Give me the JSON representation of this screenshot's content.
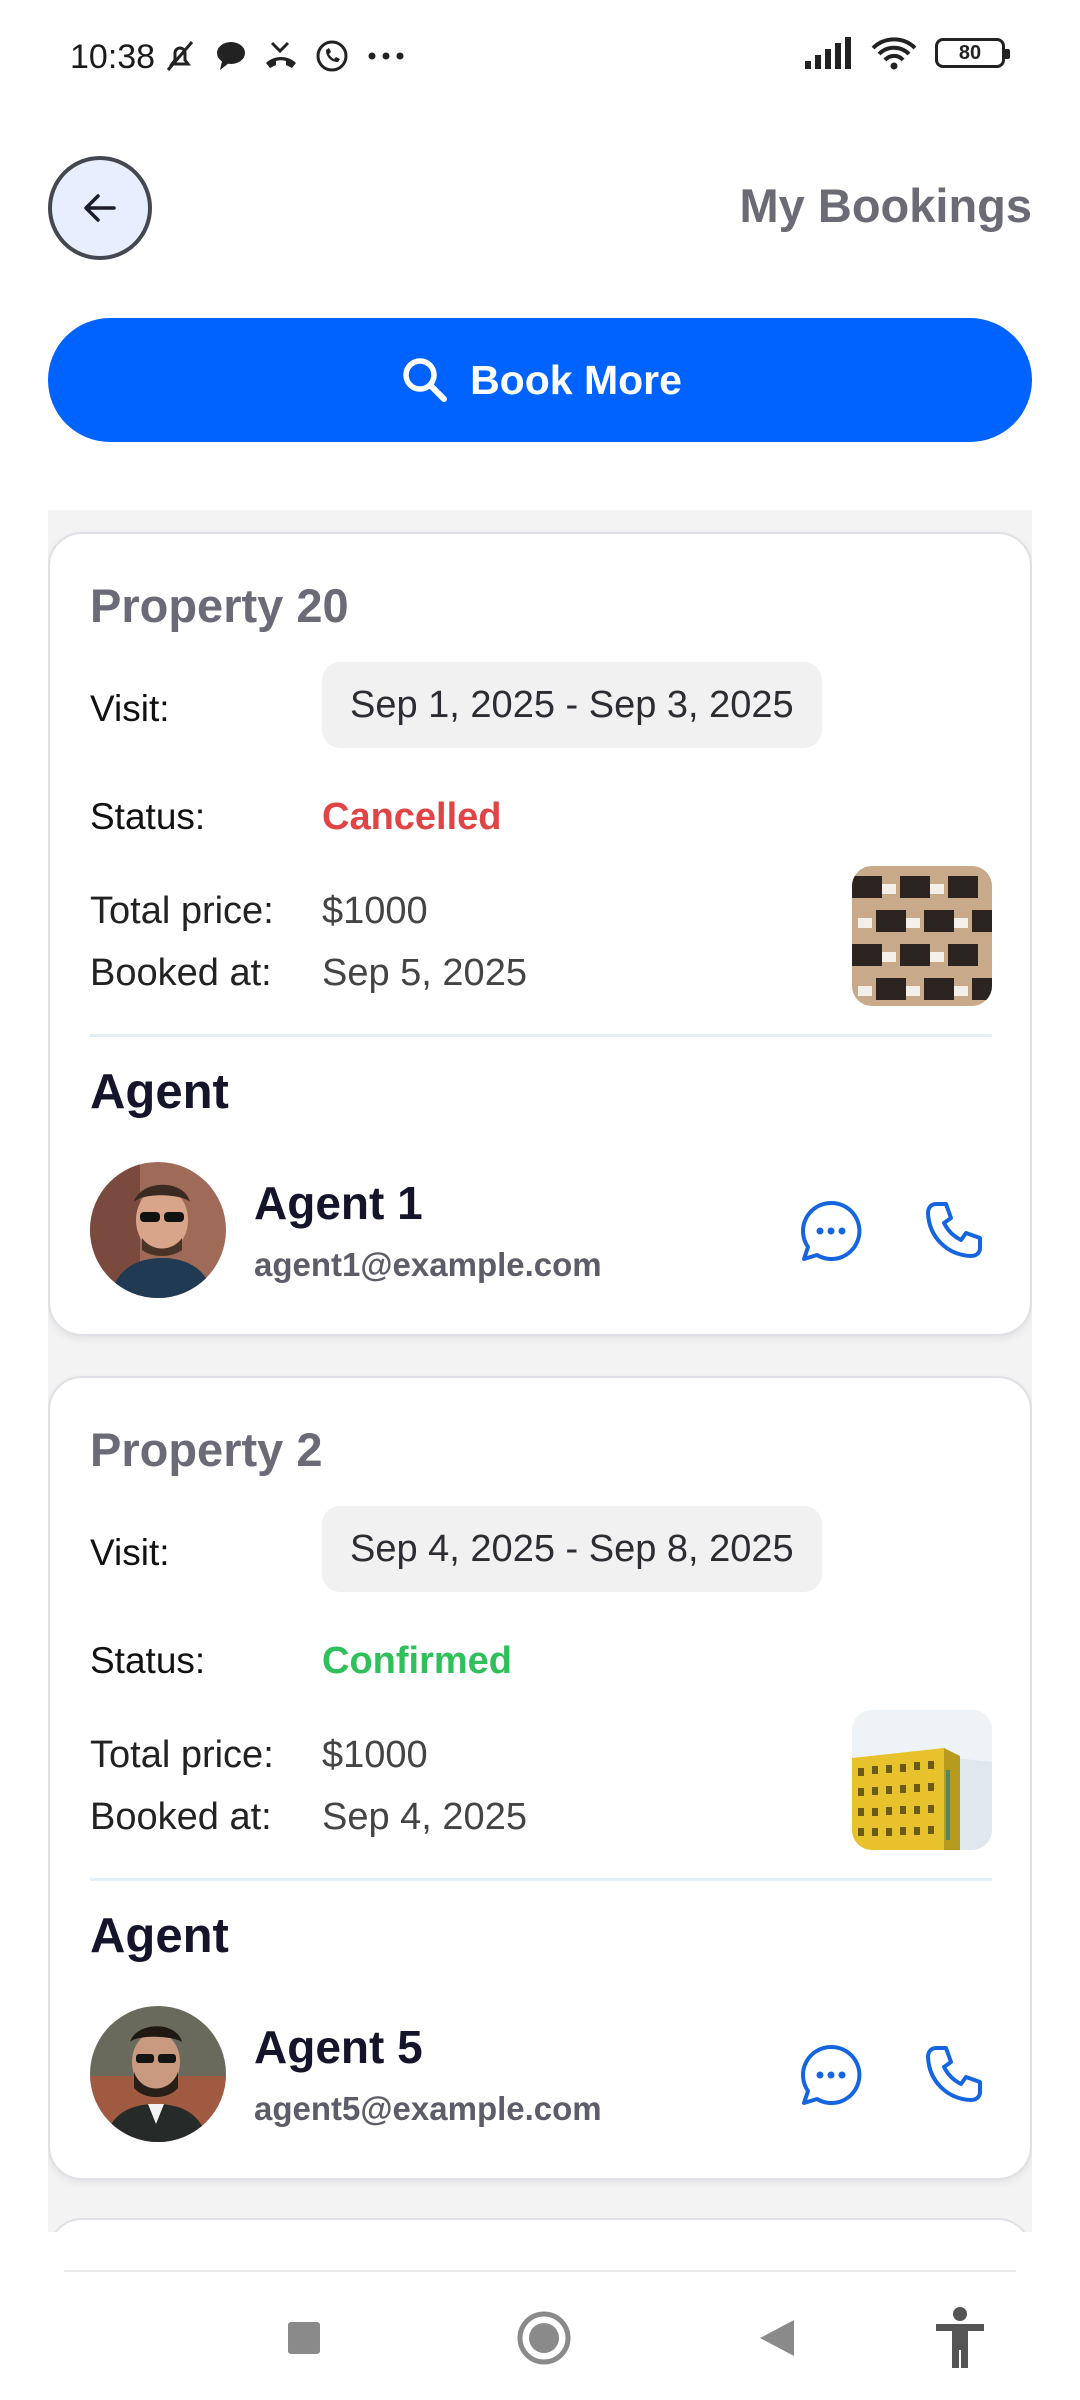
{
  "status_bar": {
    "time": "10:38",
    "battery": "80",
    "icons": [
      "mute-icon",
      "chat-bubble-icon",
      "missed-call-icon",
      "whatsapp-icon",
      "more-dots-icon",
      "signal-icon",
      "wifi-icon",
      "battery-icon"
    ]
  },
  "header": {
    "title": "My Bookings",
    "back_icon": "arrow-left-icon"
  },
  "book_more": {
    "label": "Book More",
    "icon": "search-icon",
    "color": "#0063ff"
  },
  "bookings": [
    {
      "property": "Property 20",
      "visit_label": "Visit:",
      "visit": "Sep 1, 2025 - Sep 3, 2025",
      "status_label": "Status:",
      "status": "Cancelled",
      "status_color": "#e04444",
      "price_label": "Total price:",
      "price": "$1000",
      "booked_label": "Booked at:",
      "booked_at": "Sep 5, 2025",
      "agent_heading": "Agent",
      "agent_name": "Agent 1",
      "agent_email": "agent1@example.com"
    },
    {
      "property": "Property 2",
      "visit_label": "Visit:",
      "visit": "Sep 4, 2025 - Sep 8, 2025",
      "status_label": "Status:",
      "status": "Confirmed",
      "status_color": "#2fbf5b",
      "price_label": "Total price:",
      "price": "$1000",
      "booked_label": "Booked at:",
      "booked_at": "Sep 4, 2025",
      "agent_heading": "Agent",
      "agent_name": "Agent 5",
      "agent_email": "agent5@example.com"
    }
  ],
  "nav_bar": {
    "icons": [
      "recents-square-icon",
      "home-circle-icon",
      "back-triangle-icon",
      "accessibility-icon"
    ]
  }
}
